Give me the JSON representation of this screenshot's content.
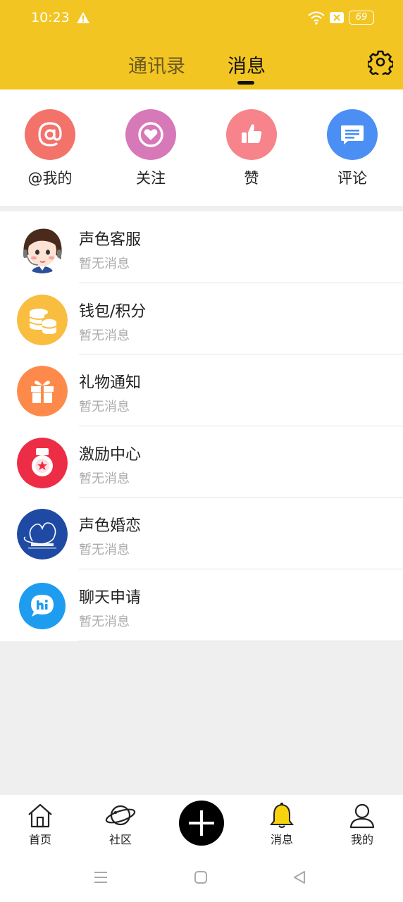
{
  "status_bar": {
    "time": "10:23",
    "battery": "69"
  },
  "header": {
    "tabs": [
      {
        "label": "通讯录",
        "active": false
      },
      {
        "label": "消息",
        "active": true
      }
    ],
    "settings_icon": "gear-icon",
    "accent_color": "#f2c522"
  },
  "quick_actions": [
    {
      "label": "@我的",
      "icon": "at-icon",
      "color": "#f3726a"
    },
    {
      "label": "关注",
      "icon": "heart-icon",
      "color": "#d778b8"
    },
    {
      "label": "赞",
      "icon": "thumbs-up-icon",
      "color": "#f6848a"
    },
    {
      "label": "评论",
      "icon": "comment-icon",
      "color": "#4b8ff5"
    }
  ],
  "messages": [
    {
      "title": "声色客服",
      "subtitle": "暂无消息",
      "icon": "customer-service-avatar"
    },
    {
      "title": "钱包/积分",
      "subtitle": "暂无消息",
      "icon": "coins-icon"
    },
    {
      "title": "礼物通知",
      "subtitle": "暂无消息",
      "icon": "gift-icon"
    },
    {
      "title": "激励中心",
      "subtitle": "暂无消息",
      "icon": "medal-icon"
    },
    {
      "title": "声色婚恋",
      "subtitle": "暂无消息",
      "icon": "love-logo-icon"
    },
    {
      "title": "聊天申请",
      "subtitle": "暂无消息",
      "icon": "hi-chat-icon"
    }
  ],
  "bottom_nav": [
    {
      "label": "首页",
      "icon": "home-icon"
    },
    {
      "label": "社区",
      "icon": "planet-icon"
    },
    {
      "label": "",
      "icon": "plus-icon"
    },
    {
      "label": "消息",
      "icon": "bell-icon",
      "active": true
    },
    {
      "label": "我的",
      "icon": "user-icon"
    }
  ]
}
